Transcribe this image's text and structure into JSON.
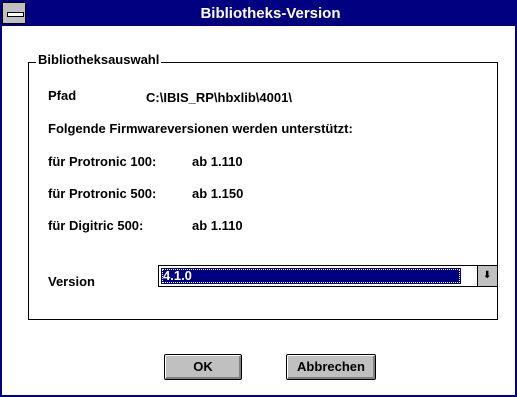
{
  "window": {
    "title": "Bibliotheks-Version"
  },
  "group": {
    "legend": "Bibliotheksauswahl"
  },
  "path": {
    "label": "Pfad",
    "value": "C:\\IBIS_RP\\hbxlib\\4001\\"
  },
  "firmware": {
    "intro": "Folgende Firmwareversionen werden unterstützt:",
    "rows": [
      {
        "device": "für Protronic 100:",
        "version": "ab 1.110"
      },
      {
        "device": "für Protronic 500:",
        "version": "ab 1.150"
      },
      {
        "device": "für Digitric 500:",
        "version": "ab 1.110"
      }
    ]
  },
  "version": {
    "label": "Version",
    "selected": "4.1.0",
    "arrow_icon": "dropdown-arrow-icon"
  },
  "buttons": {
    "ok": "OK",
    "cancel": "Abbrechen"
  },
  "colors": {
    "titlebar": "#000080",
    "selection": "#000080",
    "button_face": "#c0c0c0"
  }
}
